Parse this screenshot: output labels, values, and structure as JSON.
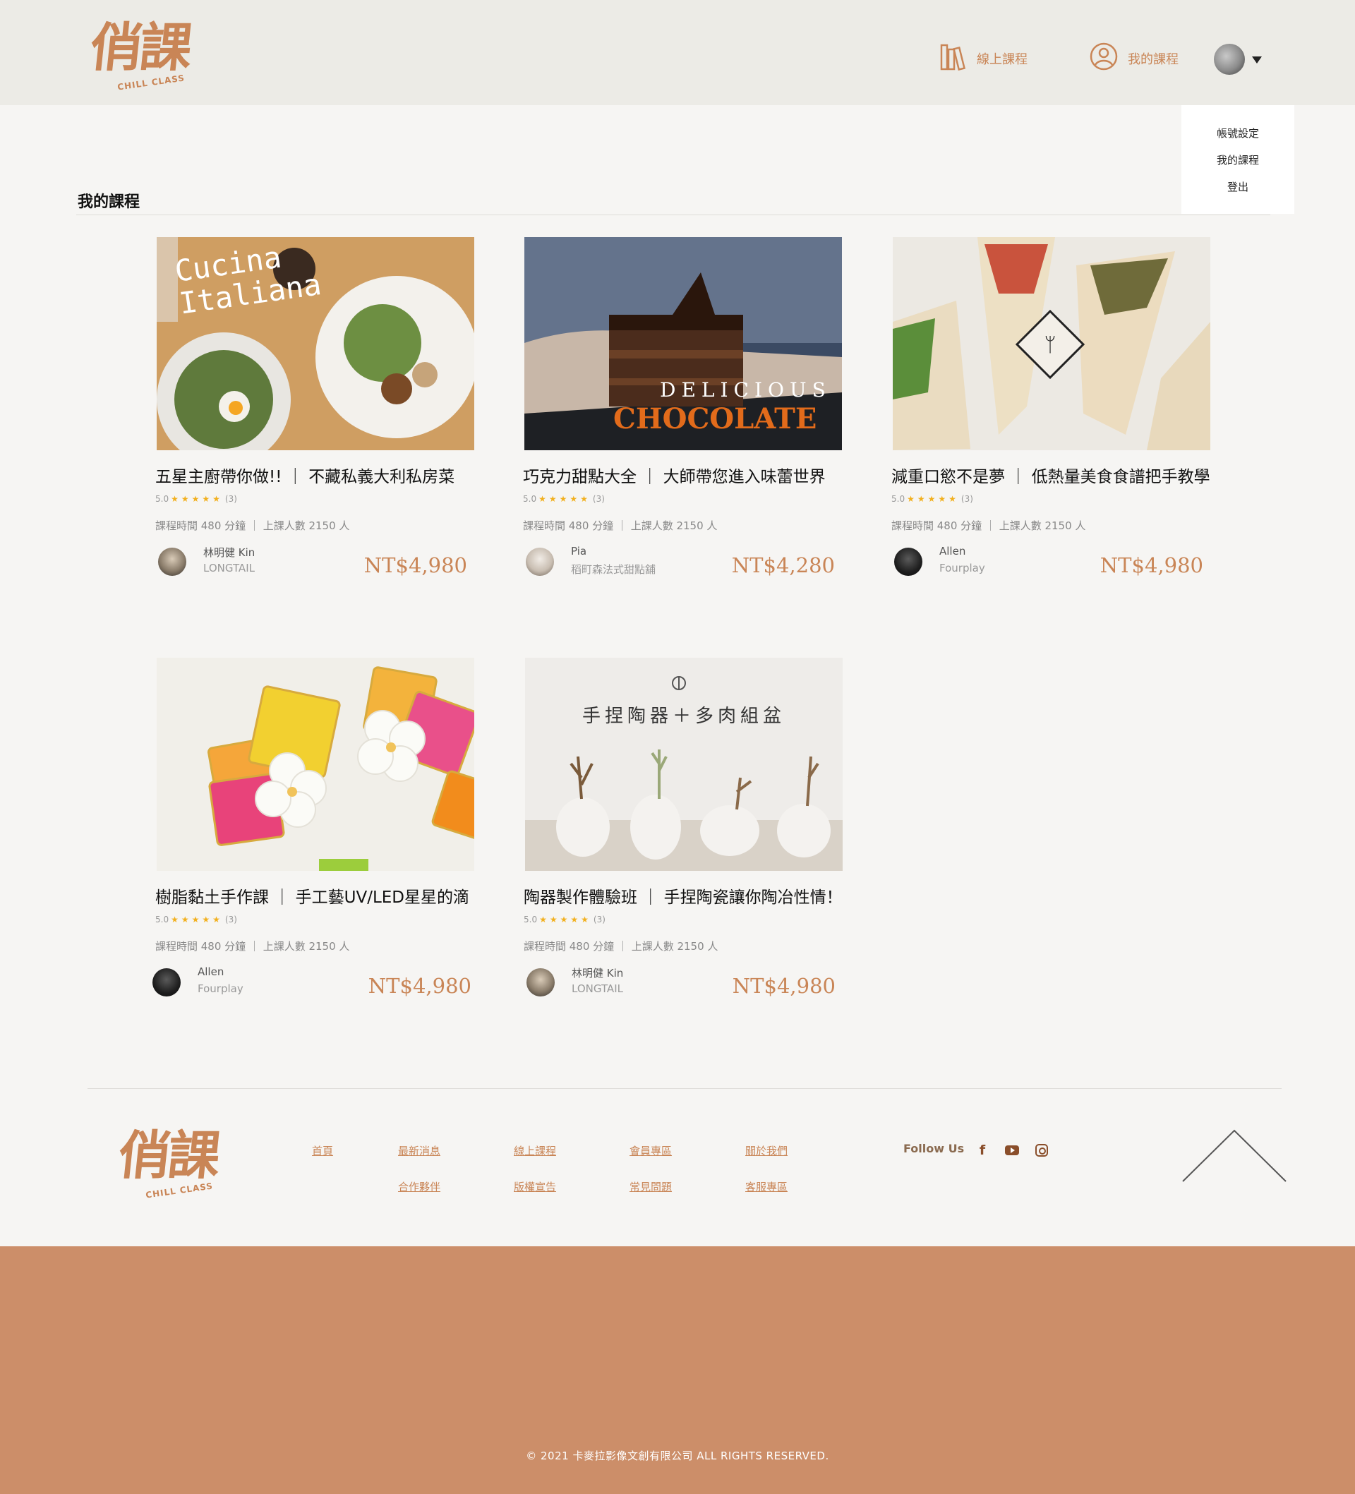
{
  "header": {
    "logo_text": "俏課",
    "logo_sub": "CHILL CLASS",
    "nav_online": "線上課程",
    "nav_mine": "我的課程"
  },
  "dropdown": {
    "items": [
      "帳號設定",
      "我的課程",
      "登出"
    ]
  },
  "page_title": "我的課程",
  "courses": [
    {
      "title": "五星主廚帶你做!! ｜ 不藏私義大利私房菜",
      "rating": "5.0",
      "stars": "★★★★★",
      "reviews": "(3)",
      "meta": "課程時間  480  分鐘 ｜ 上課人數  2150  人",
      "teacher": "林明健 Kin",
      "shop": "LONGTAIL",
      "price": "NT$4,980",
      "thumb_text": "Cucina Italiana"
    },
    {
      "title": "巧克力甜點大全 ｜ 大師帶您進入味蕾世界",
      "rating": "5.0",
      "stars": "★★★★★",
      "reviews": "(3)",
      "meta": "課程時間  480  分鐘 ｜ 上課人數  2150  人",
      "teacher": "Pia",
      "shop": "稻町森法式甜點舖",
      "price": "NT$4,280",
      "thumb_text_1": "DELICIOUS",
      "thumb_text_2": "CHOCOLATE"
    },
    {
      "title": "減重口慾不是夢 ｜ 低熱量美食食譜把手教學",
      "rating": "5.0",
      "stars": "★★★★★",
      "reviews": "(3)",
      "meta": "課程時間  480  分鐘 ｜ 上課人數  2150  人",
      "teacher": "Allen",
      "shop": "Fourplay",
      "price": "NT$4,980"
    },
    {
      "title": "樹脂黏土手作課 ｜ 手工藝UV/LED星星的滴",
      "rating": "5.0",
      "stars": "★★★★★",
      "reviews": "(3)",
      "meta": "課程時間  480  分鐘 ｜ 上課人數  2150  人",
      "teacher": "Allen",
      "shop": "Fourplay",
      "price": "NT$4,980"
    },
    {
      "title": "陶器製作體驗班 ｜ 手捏陶瓷讓你陶冶性情！",
      "rating": "5.0",
      "stars": "★★★★★",
      "reviews": "(3)",
      "meta": "課程時間  480  分鐘 ｜ 上課人數  2150  人",
      "teacher": "林明健 Kin",
      "shop": "LONGTAIL",
      "price": "NT$4,980",
      "thumb_text": "手捏陶器＋多肉組盆"
    }
  ],
  "footer": {
    "logo_text": "俏課",
    "logo_sub": "CHILL CLASS",
    "links": [
      "首頁",
      "最新消息",
      "線上課程",
      "會員專區",
      "關於我們",
      "合作夥伴",
      "版權宣告",
      "常見問題",
      "客服專區"
    ],
    "follow": "Follow Us",
    "copyright": "© 2021 卡麥拉影像文創有限公司 ALL RIGHTS RESERVED."
  },
  "colors": {
    "accent": "#c98556",
    "header_bg": "#ecebe6",
    "page_bg": "#f6f5f3",
    "footer_bar": "#cc8e69",
    "star": "#f2b01e"
  },
  "icons": {
    "nav_online": "books-icon",
    "nav_mine": "user-circle-icon",
    "back_to_top": "chevron-up-icon"
  }
}
